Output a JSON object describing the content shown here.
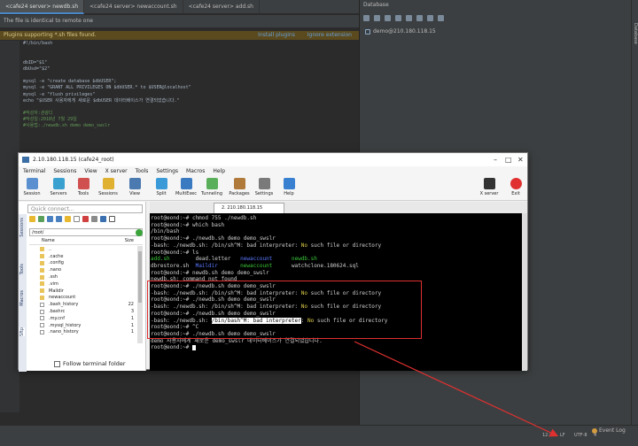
{
  "ide": {
    "tabs": [
      "<cafe24 server> newdb.sh",
      "<cafe24 server> newaccount.sh",
      "<cafe24 server> add.sh"
    ],
    "notice_identical": "The file is identical to remote one",
    "notice_plugins": "Plugins supporting *.sh files found.",
    "notice_links": [
      "Install plugins",
      "Ignore extension"
    ],
    "code_lines": [
      {
        "text": "#!/bin/bash",
        "cls": ""
      },
      {
        "text": "",
        "cls": ""
      },
      {
        "text": "",
        "cls": ""
      },
      {
        "text": "dbID=\"$1\"",
        "cls": ""
      },
      {
        "text": "dbUsd=\"$2\"",
        "cls": ""
      },
      {
        "text": "",
        "cls": ""
      },
      {
        "text": "mysql -e \"create database $dbUSER\";",
        "cls": ""
      },
      {
        "text": "mysql -e \"GRANT ALL PRIVILEGES ON $dbUSER.* to $USER@localhost\"",
        "cls": ""
      },
      {
        "text": "mysql -e \"flush privileges\"",
        "cls": ""
      },
      {
        "text": "echo \"$USER 사용자에게 새로운 $dbUSER 데이터베이스가 연결되었습니다.\"",
        "cls": ""
      },
      {
        "text": "",
        "cls": ""
      },
      {
        "text": "#작성자:관광디",
        "cls": "cmt"
      },
      {
        "text": "#작성일:2018년 7월 29일",
        "cls": "cmt"
      },
      {
        "text": "#사용법:./newdb.sh demo demo_swslr",
        "cls": "cmt"
      }
    ],
    "database_title": "Database",
    "db_tree_root": "demo@210.180.118.15",
    "right_strip": "Database",
    "status_items": [
      "12:13",
      "LF",
      "UTF-8",
      "4"
    ],
    "event_log": "Event Log"
  },
  "moba": {
    "title": "2.10.180.118.15 (cafe24_root)",
    "menu": [
      "Terminal",
      "Sessions",
      "View",
      "X server",
      "Tools",
      "Settings",
      "Macros",
      "Help"
    ],
    "toolbar": [
      {
        "label": "Session",
        "color": "#5a8fd0"
      },
      {
        "label": "Servers",
        "color": "#3aa0d0"
      },
      {
        "label": "Tools",
        "color": "#d05050"
      },
      {
        "label": "Sessions",
        "color": "#e0b030"
      },
      {
        "label": "View",
        "color": "#4a7ab0"
      },
      {
        "label": "Split",
        "color": "#3a9ad8"
      },
      {
        "label": "MultiExec",
        "color": "#3a7ac0"
      },
      {
        "label": "Tunneling",
        "color": "#5ab05a"
      },
      {
        "label": "Packages",
        "color": "#b07a3a"
      },
      {
        "label": "Settings",
        "color": "#7a7a7a"
      },
      {
        "label": "Help",
        "color": "#3a80d0"
      }
    ],
    "toolbar_right": [
      {
        "label": "X server",
        "color": "#333333"
      },
      {
        "label": "Exit",
        "color": "#e03030"
      }
    ],
    "quick_connect": "Quick connect...",
    "path": "/root/",
    "file_headers": {
      "name": "Name",
      "size": "Size"
    },
    "files": [
      {
        "name": "..",
        "size": "",
        "type": "dir"
      },
      {
        "name": ".cache",
        "size": "",
        "type": "dir"
      },
      {
        "name": ".config",
        "size": "",
        "type": "dir"
      },
      {
        "name": ".nano",
        "size": "",
        "type": "dir"
      },
      {
        "name": ".ssh",
        "size": "",
        "type": "dir"
      },
      {
        "name": ".vim",
        "size": "",
        "type": "dir"
      },
      {
        "name": "Maildir",
        "size": "",
        "type": "dir"
      },
      {
        "name": "newaccount",
        "size": "",
        "type": "dir"
      },
      {
        "name": ".bash_history",
        "size": "22",
        "type": "file"
      },
      {
        "name": ".bashrc",
        "size": "3",
        "type": "file"
      },
      {
        "name": ".my.cnf",
        "size": "1",
        "type": "file"
      },
      {
        "name": ".mysql_history",
        "size": "1",
        "type": "file"
      },
      {
        "name": ".nano_history",
        "size": "1",
        "type": "file"
      }
    ],
    "vertical_tabs": [
      "Sessions",
      "Tools",
      "Macros",
      "Sftp"
    ],
    "follow_terminal": "Follow terminal folder",
    "session_tab": "2. 210.180.118.15 (cafe24_root)",
    "terminal_lines": [
      [
        {
          "t": "root@eond:~# chmod 755 ./newdb.sh",
          "c": ""
        }
      ],
      [
        {
          "t": "root@eond:~# which bash",
          "c": ""
        }
      ],
      [
        {
          "t": "/bin/bash",
          "c": ""
        }
      ],
      [
        {
          "t": "root@eond:~# ./newdb.sh demo demo_swslr",
          "c": ""
        }
      ],
      [
        {
          "t": "-bash: ./newdb.sh: /bin/sh^M: bad interpreter: ",
          "c": ""
        },
        {
          "t": "No",
          "c": "y"
        },
        {
          "t": " such file or directory",
          "c": ""
        }
      ],
      [
        {
          "t": "root@eond:~# ls",
          "c": ""
        }
      ],
      [
        {
          "t": "add.sh",
          "c": "g"
        },
        {
          "t": "        dead.letter   ",
          "c": ""
        },
        {
          "t": "newaccount",
          "c": "b"
        },
        {
          "t": "      ",
          "c": ""
        },
        {
          "t": "newdb.sh",
          "c": "g"
        }
      ],
      [
        {
          "t": "dbrestore.sh  ",
          "c": ""
        },
        {
          "t": "Maildir",
          "c": "b"
        },
        {
          "t": "       ",
          "c": ""
        },
        {
          "t": "newaccount",
          "c": "g"
        },
        {
          "t": "      watchclone.180624.sql",
          "c": ""
        }
      ],
      [
        {
          "t": "root@eond:~# newdb.sh demo demo_swslr",
          "c": ""
        }
      ],
      [
        {
          "t": "newdb.sh: command not found",
          "c": ""
        }
      ],
      [
        {
          "t": "root@eond:~# ./newdb.sh demo demo_swslr",
          "c": ""
        }
      ],
      [
        {
          "t": "-bash: ./newdb.sh: /bin/sh^M: bad interpreter: ",
          "c": ""
        },
        {
          "t": "No",
          "c": "y"
        },
        {
          "t": " such file or directory",
          "c": ""
        }
      ],
      [
        {
          "t": "root@eond:~# ./newdb.sh demo demo_swslr",
          "c": ""
        }
      ],
      [
        {
          "t": "-bash: ./newdb.sh: /bin/sh^M: bad interpreter: ",
          "c": ""
        },
        {
          "t": "No",
          "c": "y"
        },
        {
          "t": " such file or directory",
          "c": ""
        }
      ],
      [
        {
          "t": "root@eond:~# ./newdb.sh demo demo_swslr",
          "c": ""
        }
      ],
      [
        {
          "t": "-bash: ./newdb.sh: ",
          "c": ""
        },
        {
          "t": "/bin/bash^M: bad interpreter",
          "c": "inv"
        },
        {
          "t": ": ",
          "c": ""
        },
        {
          "t": "No",
          "c": "y"
        },
        {
          "t": " such file or directory",
          "c": ""
        }
      ],
      [
        {
          "t": "root@eond:~# ^C",
          "c": ""
        }
      ],
      [
        {
          "t": "root@eond:~# ./newdb.sh demo demo_swslr",
          "c": ""
        }
      ],
      [
        {
          "t": "demo 사용자에게 새로운 demo_swslr 데이터베이스가 연결되었습니다.",
          "c": ""
        }
      ],
      [
        {
          "t": "root@eond:~# ",
          "c": ""
        }
      ]
    ]
  }
}
